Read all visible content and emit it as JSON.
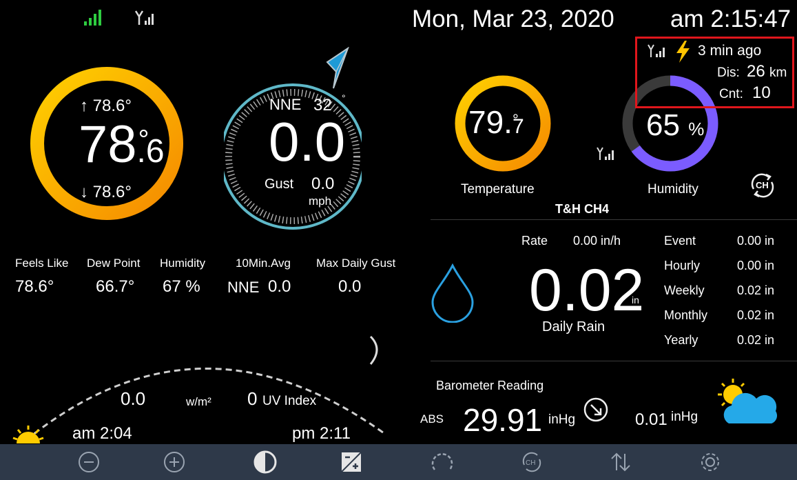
{
  "status": {
    "wifi_icon": "wifi-signal-icon",
    "sensor_icon": "sensor-signal-icon"
  },
  "datetime": {
    "date": "Mon, Mar  23,  2020",
    "time": "am 2:15:47"
  },
  "outdoor": {
    "temp_main": "78",
    "temp_dec": "6",
    "temp_unit": "°",
    "temp_high": "78.6°",
    "temp_low": "78.6°",
    "arrow_up": "↑",
    "arrow_down": "↓",
    "accent": "#f5a300"
  },
  "wind": {
    "direction": "NNE",
    "degrees": "32",
    "degree_symbol": "°",
    "speed": "0.0",
    "gust_label": "Gust",
    "gust": "0.0",
    "unit": "mph",
    "ring_color": "#5fb8c8",
    "pointer_color": "#1e9ad6"
  },
  "stats": {
    "feels_like_label": "Feels Like",
    "feels_like": "78.6°",
    "dew_point_label": "Dew Point",
    "dew_point": "66.7°",
    "humidity_label": "Humidity",
    "humidity": "67 %",
    "avg_label": "10Min.Avg",
    "avg_dir": "NNE",
    "avg_speed": "0.0",
    "max_gust_label": "Max Daily Gust",
    "max_gust": "0.0"
  },
  "solar": {
    "radiation": "0.0",
    "radiation_unit": "w/m²",
    "uv": "0",
    "uv_label": "UV Index",
    "sunrise": "am 2:04",
    "sunset": "pm 2:11"
  },
  "lightning": {
    "ago": "3 min ago",
    "dis_label": "Dis:",
    "dis_value": "26",
    "dis_unit": "km",
    "cnt_label": "Cnt:",
    "cnt_value": "10",
    "highlight": "#e0161c"
  },
  "channel": {
    "temp_main": "79.",
    "temp_dec": "7",
    "temp_unit": "°",
    "temp_label": "Temperature",
    "humidity": "65",
    "humidity_unit": "%",
    "humidity_label": "Humidity",
    "humidity_fill": 0.65,
    "humidity_color": "#7b5cff",
    "name": "T&H CH4",
    "ch_label": "CH"
  },
  "rain": {
    "rate_label": "Rate",
    "rate": "0.00 in/h",
    "daily": "0.02",
    "daily_unit": "in",
    "daily_label": "Daily Rain",
    "rows": [
      {
        "label": "Event",
        "value": "0.00 in"
      },
      {
        "label": "Hourly",
        "value": "0.00 in"
      },
      {
        "label": "Weekly",
        "value": "0.02 in"
      },
      {
        "label": "Monthly",
        "value": "0.02 in"
      },
      {
        "label": "Yearly",
        "value": "0.02 in"
      }
    ],
    "drop_color": "#2aa0e0"
  },
  "barometer": {
    "title": "Barometer Reading",
    "mode": "ABS",
    "value": "29.91",
    "unit": "inHg",
    "change": "0.01",
    "change_unit": "inHg"
  },
  "toolbar": [
    {
      "name": "zoom-out",
      "icon": "minus-circle-icon"
    },
    {
      "name": "zoom-in",
      "icon": "plus-circle-icon"
    },
    {
      "name": "contrast",
      "icon": "contrast-icon"
    },
    {
      "name": "calibrate",
      "icon": "edit-plus-icon"
    },
    {
      "name": "gauge",
      "icon": "gauge-icon"
    },
    {
      "name": "channel",
      "icon": "channel-cycle-icon"
    },
    {
      "name": "sort",
      "icon": "up-down-arrows-icon"
    },
    {
      "name": "settings",
      "icon": "gear-icon"
    }
  ]
}
